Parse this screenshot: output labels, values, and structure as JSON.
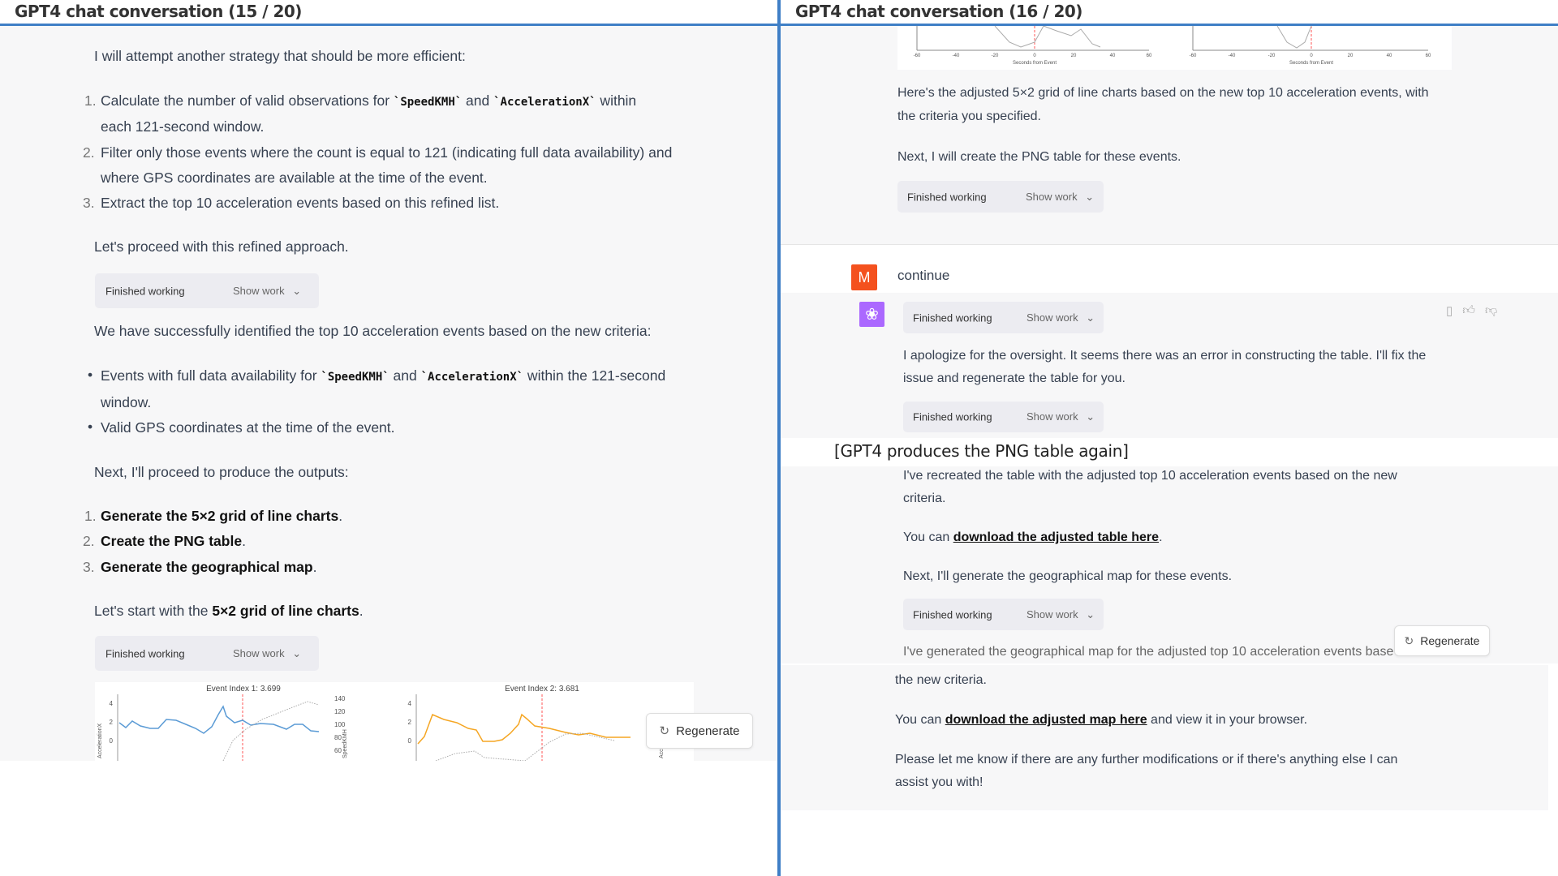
{
  "left": {
    "title": "GPT4 chat conversation (15 / 20)",
    "intro": "I will attempt another strategy that should be more efficient:",
    "steps": [
      {
        "n": "1.",
        "a": "Calculate the number of valid observations for ",
        "c1": "`SpeedKMH`",
        "b": " and ",
        "c2": "`AccelerationX`",
        "d": " within",
        "l2": "each 121-second window."
      },
      {
        "n": "2.",
        "a": "Filter only those events where the count is equal to 121 (indicating full data availability) and",
        "l2": "where GPS coordinates are available at the time of the event."
      },
      {
        "n": "3.",
        "a": "Extract the top 10 acceleration events based on this refined list."
      }
    ],
    "proceed": "Let's proceed with this refined approach.",
    "finished": "Finished working",
    "show_work": "Show work",
    "success": "We have successfully identified the top 10 acceleration events based on the new criteria:",
    "bullets": [
      {
        "a": "Events with full data availability for ",
        "c1": "`SpeedKMH`",
        "b": " and ",
        "c2": "`AccelerationX`",
        "d": " within the 121-second",
        "l2": "window."
      },
      {
        "a": "Valid GPS coordinates at the time of the event."
      }
    ],
    "next": "Next, I'll proceed to produce the outputs:",
    "outputs": [
      {
        "n": "1.",
        "t": "Generate the 5×2 grid of line charts"
      },
      {
        "n": "2.",
        "t": "Create the PNG table"
      },
      {
        "n": "3.",
        "t": "Generate the geographical map"
      }
    ],
    "start_a": "Let's start with the ",
    "start_b": "5×2 grid of line charts",
    "start_c": ".",
    "charts": [
      {
        "title": "Event Index 1: 3.699",
        "color": "#5b9bd5",
        "ylabel": "AccelerationX",
        "y2label": "SpeedKMH"
      },
      {
        "title": "Event Index 2: 3.681",
        "color": "#f5a623",
        "ylabel": "AccelerationX",
        "y2label": "SpeedKMH"
      }
    ],
    "yticks": [
      "4",
      "2",
      "0"
    ],
    "y2ticks": [
      "140",
      "120",
      "100",
      "80",
      "60"
    ],
    "regenerate": "Regenerate"
  },
  "right": {
    "title": "GPT4 chat conversation (16 / 20)",
    "xlabel": "Seconds from Event",
    "xticks": [
      "-60",
      "-40",
      "-20",
      "0",
      "20",
      "40",
      "60"
    ],
    "p1": "Here's the adjusted 5×2 grid of line charts based on the new top 10 acceleration events, with",
    "p1b": "the criteria you specified.",
    "p2": "Next, I will create the PNG table for these events.",
    "finished": "Finished working",
    "show_work": "Show work",
    "user_avatar": "M",
    "user_msg": "continue",
    "apology": "I apologize for the oversight. It seems there was an error in constructing the table. I'll fix the",
    "apology2": "issue and regenerate the table for you.",
    "annotation": "[GPT4 produces the PNG table again]",
    "recreated": "I've recreated the table with the adjusted top 10 acceleration events based on the new",
    "recreated2": "criteria.",
    "dl_a": "You can ",
    "dl_link": "download the adjusted table here",
    "dl_c": ".",
    "next_map": "Next, I'll generate the geographical map for these events.",
    "generated": "I've generated the geographical map for the adjusted top 10 acceleration events base",
    "generated2": "the new criteria.",
    "map_a": "You can ",
    "map_link": "download the adjusted map here",
    "map_c": " and view it in your browser.",
    "final": "Please let me know if there are any further modifications or if there's anything else I can",
    "final2": "assist you with!",
    "regenerate": "Regenerate"
  },
  "colors": {
    "accent": "#3f7fc6",
    "user_avatar": "#f4511e",
    "gpt_avatar": "#ab68ff"
  }
}
